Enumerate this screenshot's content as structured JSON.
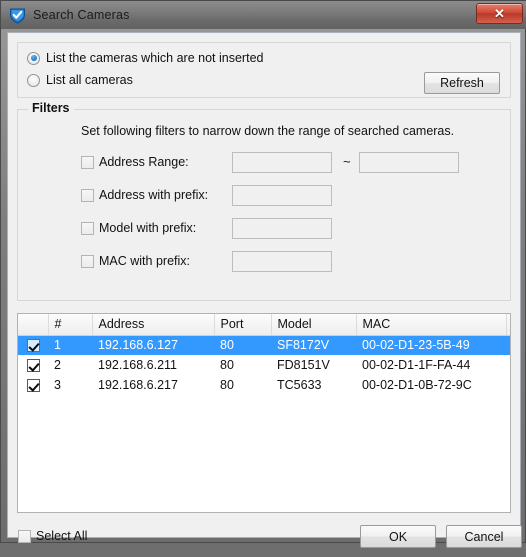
{
  "window": {
    "title": "Search Cameras",
    "icon": "shield-check-icon",
    "close_label": "✕",
    "accent_color": "#3399ff",
    "close_color": "#cf4a36"
  },
  "mode": {
    "options": [
      {
        "label": "List the cameras which are not inserted",
        "checked": true
      },
      {
        "label": "List all cameras",
        "checked": false
      }
    ],
    "refresh_label": "Refresh"
  },
  "filters": {
    "legend": "Filters",
    "description": "Set following filters to narrow down the range of searched cameras.",
    "tilde": "~",
    "rows": [
      {
        "label": "Address Range:",
        "checked": false,
        "value": "",
        "placeholder": "",
        "value2": "",
        "placeholder2": ""
      },
      {
        "label": "Address with prefix:",
        "checked": false,
        "value": "",
        "placeholder": ""
      },
      {
        "label": "Model with prefix:",
        "checked": false,
        "value": "",
        "placeholder": ""
      },
      {
        "label": "MAC with prefix:",
        "checked": false,
        "value": "",
        "placeholder": ""
      }
    ]
  },
  "results": {
    "columns": [
      "",
      "#",
      "Address",
      "Port",
      "Model",
      "MAC",
      ""
    ],
    "rows": [
      {
        "checked": true,
        "selected": true,
        "num": "1",
        "address": "192.168.6.127",
        "port": "80",
        "model": "SF8172V",
        "mac": "00-02-D1-23-5B-49"
      },
      {
        "checked": true,
        "selected": false,
        "num": "2",
        "address": "192.168.6.211",
        "port": "80",
        "model": "FD8151V",
        "mac": "00-02-D1-1F-FA-44"
      },
      {
        "checked": true,
        "selected": false,
        "num": "3",
        "address": "192.168.6.217",
        "port": "80",
        "model": "TC5633",
        "mac": "00-02-D1-0B-72-9C"
      }
    ]
  },
  "footer": {
    "select_all_label": "Select All",
    "select_all_checked": false,
    "ok_label": "OK",
    "cancel_label": "Cancel"
  }
}
